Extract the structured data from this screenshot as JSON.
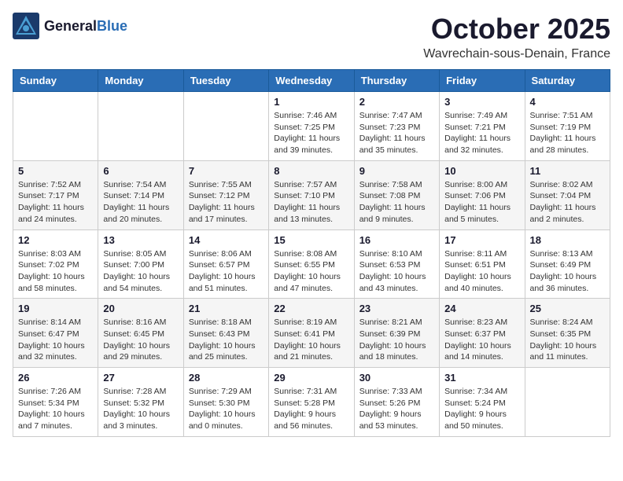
{
  "header": {
    "logo_general": "General",
    "logo_blue": "Blue",
    "month": "October 2025",
    "location": "Wavrechain-sous-Denain, France"
  },
  "weekdays": [
    "Sunday",
    "Monday",
    "Tuesday",
    "Wednesday",
    "Thursday",
    "Friday",
    "Saturday"
  ],
  "weeks": [
    [
      {
        "day": "",
        "info": ""
      },
      {
        "day": "",
        "info": ""
      },
      {
        "day": "",
        "info": ""
      },
      {
        "day": "1",
        "info": "Sunrise: 7:46 AM\nSunset: 7:25 PM\nDaylight: 11 hours\nand 39 minutes."
      },
      {
        "day": "2",
        "info": "Sunrise: 7:47 AM\nSunset: 7:23 PM\nDaylight: 11 hours\nand 35 minutes."
      },
      {
        "day": "3",
        "info": "Sunrise: 7:49 AM\nSunset: 7:21 PM\nDaylight: 11 hours\nand 32 minutes."
      },
      {
        "day": "4",
        "info": "Sunrise: 7:51 AM\nSunset: 7:19 PM\nDaylight: 11 hours\nand 28 minutes."
      }
    ],
    [
      {
        "day": "5",
        "info": "Sunrise: 7:52 AM\nSunset: 7:17 PM\nDaylight: 11 hours\nand 24 minutes."
      },
      {
        "day": "6",
        "info": "Sunrise: 7:54 AM\nSunset: 7:14 PM\nDaylight: 11 hours\nand 20 minutes."
      },
      {
        "day": "7",
        "info": "Sunrise: 7:55 AM\nSunset: 7:12 PM\nDaylight: 11 hours\nand 17 minutes."
      },
      {
        "day": "8",
        "info": "Sunrise: 7:57 AM\nSunset: 7:10 PM\nDaylight: 11 hours\nand 13 minutes."
      },
      {
        "day": "9",
        "info": "Sunrise: 7:58 AM\nSunset: 7:08 PM\nDaylight: 11 hours\nand 9 minutes."
      },
      {
        "day": "10",
        "info": "Sunrise: 8:00 AM\nSunset: 7:06 PM\nDaylight: 11 hours\nand 5 minutes."
      },
      {
        "day": "11",
        "info": "Sunrise: 8:02 AM\nSunset: 7:04 PM\nDaylight: 11 hours\nand 2 minutes."
      }
    ],
    [
      {
        "day": "12",
        "info": "Sunrise: 8:03 AM\nSunset: 7:02 PM\nDaylight: 10 hours\nand 58 minutes."
      },
      {
        "day": "13",
        "info": "Sunrise: 8:05 AM\nSunset: 7:00 PM\nDaylight: 10 hours\nand 54 minutes."
      },
      {
        "day": "14",
        "info": "Sunrise: 8:06 AM\nSunset: 6:57 PM\nDaylight: 10 hours\nand 51 minutes."
      },
      {
        "day": "15",
        "info": "Sunrise: 8:08 AM\nSunset: 6:55 PM\nDaylight: 10 hours\nand 47 minutes."
      },
      {
        "day": "16",
        "info": "Sunrise: 8:10 AM\nSunset: 6:53 PM\nDaylight: 10 hours\nand 43 minutes."
      },
      {
        "day": "17",
        "info": "Sunrise: 8:11 AM\nSunset: 6:51 PM\nDaylight: 10 hours\nand 40 minutes."
      },
      {
        "day": "18",
        "info": "Sunrise: 8:13 AM\nSunset: 6:49 PM\nDaylight: 10 hours\nand 36 minutes."
      }
    ],
    [
      {
        "day": "19",
        "info": "Sunrise: 8:14 AM\nSunset: 6:47 PM\nDaylight: 10 hours\nand 32 minutes."
      },
      {
        "day": "20",
        "info": "Sunrise: 8:16 AM\nSunset: 6:45 PM\nDaylight: 10 hours\nand 29 minutes."
      },
      {
        "day": "21",
        "info": "Sunrise: 8:18 AM\nSunset: 6:43 PM\nDaylight: 10 hours\nand 25 minutes."
      },
      {
        "day": "22",
        "info": "Sunrise: 8:19 AM\nSunset: 6:41 PM\nDaylight: 10 hours\nand 21 minutes."
      },
      {
        "day": "23",
        "info": "Sunrise: 8:21 AM\nSunset: 6:39 PM\nDaylight: 10 hours\nand 18 minutes."
      },
      {
        "day": "24",
        "info": "Sunrise: 8:23 AM\nSunset: 6:37 PM\nDaylight: 10 hours\nand 14 minutes."
      },
      {
        "day": "25",
        "info": "Sunrise: 8:24 AM\nSunset: 6:35 PM\nDaylight: 10 hours\nand 11 minutes."
      }
    ],
    [
      {
        "day": "26",
        "info": "Sunrise: 7:26 AM\nSunset: 5:34 PM\nDaylight: 10 hours\nand 7 minutes."
      },
      {
        "day": "27",
        "info": "Sunrise: 7:28 AM\nSunset: 5:32 PM\nDaylight: 10 hours\nand 3 minutes."
      },
      {
        "day": "28",
        "info": "Sunrise: 7:29 AM\nSunset: 5:30 PM\nDaylight: 10 hours\nand 0 minutes."
      },
      {
        "day": "29",
        "info": "Sunrise: 7:31 AM\nSunset: 5:28 PM\nDaylight: 9 hours\nand 56 minutes."
      },
      {
        "day": "30",
        "info": "Sunrise: 7:33 AM\nSunset: 5:26 PM\nDaylight: 9 hours\nand 53 minutes."
      },
      {
        "day": "31",
        "info": "Sunrise: 7:34 AM\nSunset: 5:24 PM\nDaylight: 9 hours\nand 50 minutes."
      },
      {
        "day": "",
        "info": ""
      }
    ]
  ]
}
